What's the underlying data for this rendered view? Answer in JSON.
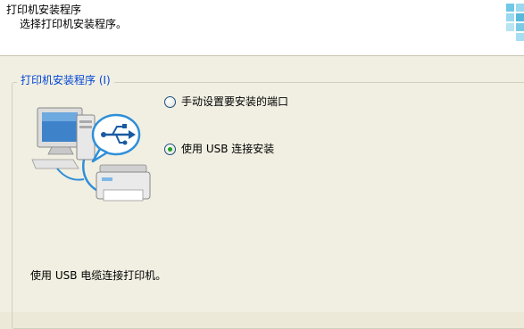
{
  "header": {
    "title": "打印机安装程序",
    "subtitle": "选择打印机安装程序。"
  },
  "group": {
    "legend": "打印机安装程序 (I)",
    "options": [
      {
        "label": "手动设置要安装的端口",
        "selected": false
      },
      {
        "label": "使用 USB 连接安装",
        "selected": true
      }
    ]
  },
  "description": "使用 USB 电缆连接打印机。",
  "icons": {
    "header_logo": "windows-flag-icon",
    "illustration": "computer-printer-usb-icon"
  },
  "colors": {
    "legend_text": "#0046d5",
    "dialog_background": "#f1efe2",
    "header_background": "#ffffff",
    "radio_dot": "#21a121"
  }
}
